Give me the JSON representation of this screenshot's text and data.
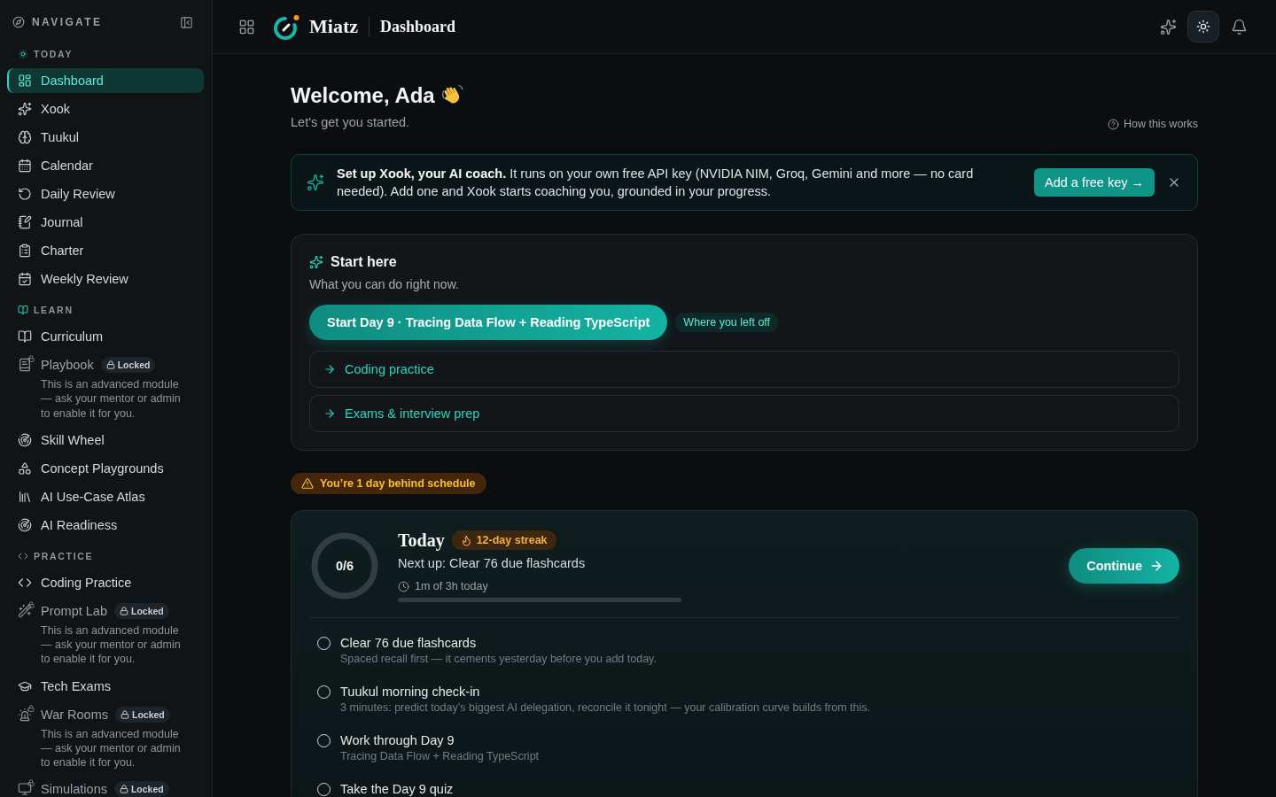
{
  "sidebar": {
    "title": "NAVIGATE",
    "sections": [
      {
        "label": "TODAY",
        "items": [
          {
            "label": "Dashboard",
            "selected": true,
            "locked": false
          },
          {
            "label": "Xook",
            "selected": false,
            "locked": false
          },
          {
            "label": "Tuukul",
            "selected": false,
            "locked": false
          },
          {
            "label": "Calendar",
            "selected": false,
            "locked": false
          },
          {
            "label": "Daily Review",
            "selected": false,
            "locked": false
          },
          {
            "label": "Journal",
            "selected": false,
            "locked": false
          },
          {
            "label": "Charter",
            "selected": false,
            "locked": false
          },
          {
            "label": "Weekly Review",
            "selected": false,
            "locked": false
          }
        ]
      },
      {
        "label": "LEARN",
        "items": [
          {
            "label": "Curriculum",
            "selected": false,
            "locked": false
          },
          {
            "label": "Playbook",
            "selected": false,
            "locked": true,
            "badge": "Locked",
            "note": "This is an advanced module — ask your mentor or admin to enable it for you."
          },
          {
            "label": "Skill Wheel",
            "selected": false,
            "locked": false
          },
          {
            "label": "Concept Playgrounds",
            "selected": false,
            "locked": false
          },
          {
            "label": "AI Use-Case Atlas",
            "selected": false,
            "locked": false
          },
          {
            "label": "AI Readiness",
            "selected": false,
            "locked": false
          }
        ]
      },
      {
        "label": "PRACTICE",
        "items": [
          {
            "label": "Coding Practice",
            "selected": false,
            "locked": false
          },
          {
            "label": "Prompt Lab",
            "selected": false,
            "locked": true,
            "badge": "Locked",
            "note": "This is an advanced module — ask your mentor or admin to enable it for you."
          },
          {
            "label": "Tech Exams",
            "selected": false,
            "locked": false
          },
          {
            "label": "War Rooms",
            "selected": false,
            "locked": true,
            "badge": "Locked",
            "note": "This is an advanced module — ask your mentor or admin to enable it for you."
          },
          {
            "label": "Simulations",
            "selected": false,
            "locked": true,
            "badge": "Locked"
          }
        ]
      }
    ]
  },
  "header": {
    "brand": "Miatz",
    "page_title": "Dashboard"
  },
  "welcome": {
    "title": "Welcome, Ada",
    "subtitle": "Let's get you started.",
    "help_link": "How this works"
  },
  "banner": {
    "text": "**Set up Xook, your AI coach.** It runs on your own free API key (NVIDIA NIM, Groq, Gemini and more — no card needed). Add one and Xook starts coaching you, grounded in your progress.",
    "button": "Add a free key →"
  },
  "start_here": {
    "title": "Start here",
    "subtitle": "What you can do right now.",
    "primary_button": "Start Day 9 · Tracing Data Flow + Reading TypeScript",
    "primary_badge": "Where you left off",
    "links": [
      "Coding practice",
      "Exams & interview prep"
    ]
  },
  "schedule_alert": "You’re 1 day behind schedule",
  "today": {
    "title": "Today",
    "streak": "12-day streak",
    "progress": {
      "label": "0/6",
      "level": 0
    },
    "next_up": "Next up: Clear 76 due flashcards",
    "time": {
      "label": "1m of 3h today",
      "level": 0
    },
    "button": "Continue",
    "tasks": [
      {
        "title": "Clear 76 due flashcards",
        "detail": "Spaced recall first — it cements yesterday before you add today.",
        "checked": false
      },
      {
        "title": "Tuukul morning check-in",
        "detail": "3 minutes: predict today’s biggest AI delegation, reconcile it tonight — your calibration curve builds from this.",
        "checked": false
      },
      {
        "title": "Work through Day 9",
        "detail": "Tracing Data Flow + Reading TypeScript",
        "checked": false
      },
      {
        "title": "Take the Day 9 quiz",
        "checked": false
      }
    ]
  }
}
